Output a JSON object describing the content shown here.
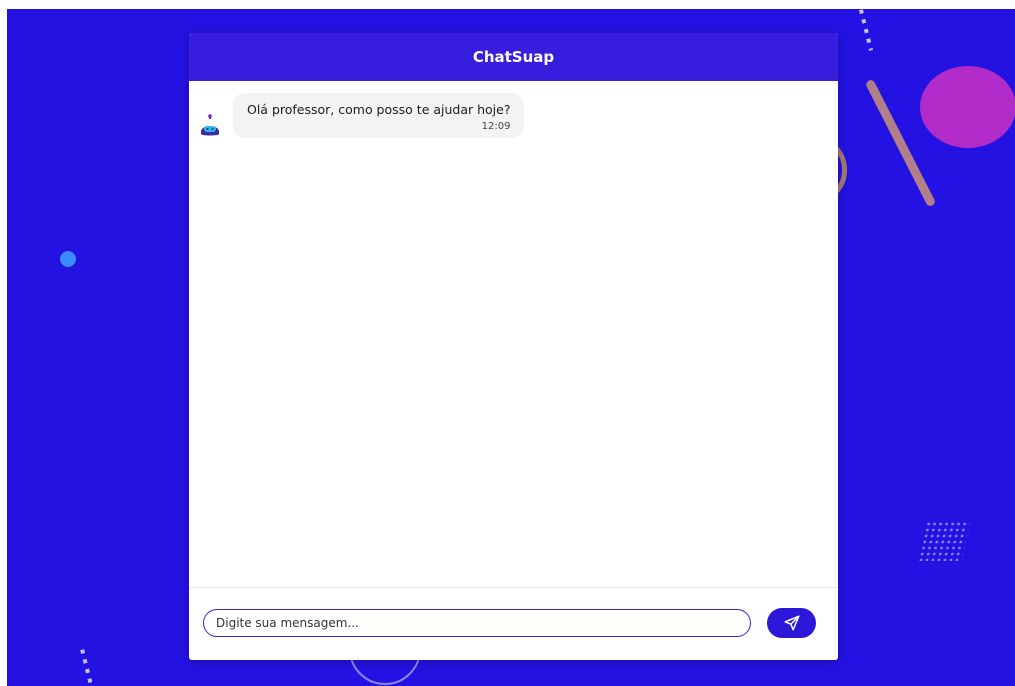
{
  "app": {
    "title": "ChatSuap"
  },
  "messages": [
    {
      "sender": "bot",
      "text": "Olá professor, como posso te ajudar hoje?",
      "time": "12:09"
    }
  ],
  "composer": {
    "placeholder": "Digite sua mensagem...",
    "value": "",
    "send_icon": "send-icon"
  },
  "colors": {
    "background": "#2412e2",
    "header": "#371edf",
    "accent": "#2d17d8",
    "bubble": "#f3f3f6"
  }
}
